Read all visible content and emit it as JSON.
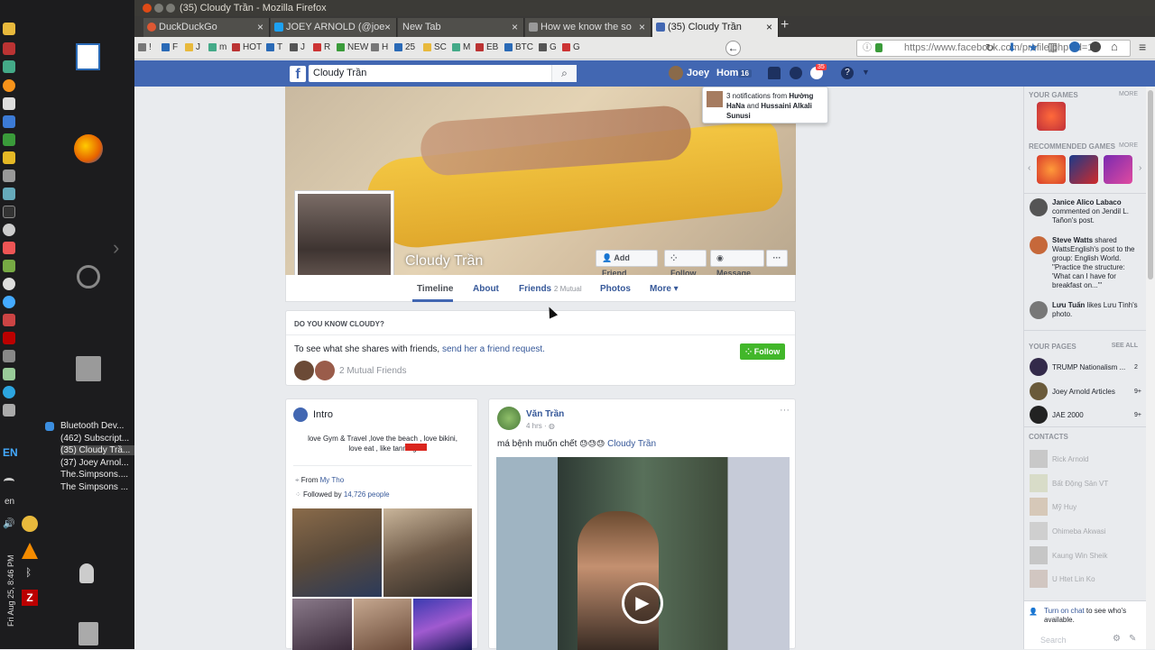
{
  "window": {
    "title": "(35) Cloudy Trần - Mozilla Firefox"
  },
  "tabs": [
    {
      "label": "DuckDuckGo",
      "color": "#de5833"
    },
    {
      "label": "JOEY ARNOLD (@joe",
      "color": "#1da1f2"
    },
    {
      "label": "New Tab",
      "color": ""
    },
    {
      "label": "How we know the so",
      "color": "#555555"
    },
    {
      "label": "(35) Cloudy Trần",
      "color": "#4267b2"
    }
  ],
  "toolbar": {
    "url": "https://www.facebook.com/profile.php?id=10",
    "bookmarks": [
      "!",
      "F",
      "J",
      "m",
      "HOT",
      "T",
      "J",
      "R",
      "NEW",
      "H",
      "25",
      "SC",
      "M",
      "EB",
      "BTC",
      "G",
      "G"
    ]
  },
  "launcher": {
    "taskbar_items": [
      "Bluetooth Dev...",
      "(462) Subscript...",
      "(35) Cloudy Trầ...",
      "(37) Joey Arnol...",
      "The.Simpsons....",
      "The Simpsons ..."
    ],
    "lang": "EN",
    "lang2": "en",
    "clock": "Fri Aug 25, 8:46 PM"
  },
  "fb": {
    "search_value": "Cloudy Trần",
    "user": "Joey",
    "home": "Home",
    "home_count": "16",
    "notif_count": "35",
    "notif_popup": {
      "pre": "3 notifications from ",
      "name1": "Hường HaNa",
      "and": " and ",
      "name2": "Hussaini Alkali Sunusi"
    },
    "profile_name": "Cloudy Trần",
    "buttons": {
      "add_friend": "Add Friend",
      "follow": "Follow",
      "message": "Message",
      "more": "···"
    },
    "profile_tabs": {
      "timeline": "Timeline",
      "about": "About",
      "friends": "Friends",
      "mutual": "2 Mutual",
      "photos": "Photos",
      "more": "More ▾"
    },
    "know": {
      "header": "DO YOU KNOW CLOUDY?",
      "text": "To see what she shares with friends, ",
      "link": "send her a friend request.",
      "mutual": "2 Mutual Friends",
      "follow": "Follow"
    },
    "intro": {
      "title": "Intro",
      "bio": "love Gym & Travel ,love the beach , love bikini, love eat , like tanning",
      "from_label": "From ",
      "from_place": "My Tho",
      "followed_label": "Followed by ",
      "followed_count": "14,726 people"
    },
    "post": {
      "author": "Văn Trần",
      "time": "4 hrs · ",
      "text": "má bệnh muốn chết",
      "emojis": "😓😓😓",
      "tag": "Cloudy Trần",
      "more": "···"
    }
  },
  "sidebar": {
    "your_games": "YOUR GAMES",
    "more": "MORE",
    "recommended": "RECOMMENDED GAMES",
    "ticker": [
      {
        "name": "Janice Alico Labaco",
        "text": " commented on Jendil L. Tañon's post."
      },
      {
        "name": "Steve Watts",
        "text": " shared WattsEnglish's post to the group: English World. \"Practice the structure: 'What can I have for breakfast on...'\""
      },
      {
        "name": "Lưu Tuấn",
        "text": " likes Lưu Tình's photo."
      }
    ],
    "your_pages": "YOUR PAGES",
    "see_all": "SEE ALL",
    "pages": [
      {
        "name": "TRUMP Nationalism ...",
        "count": "2"
      },
      {
        "name": "Joey Arnold Articles",
        "count": "9+"
      },
      {
        "name": "JAE 2000",
        "count": "9+"
      }
    ],
    "contacts_header": "CONTACTS",
    "contacts": [
      "Rick Arnold",
      "Bất Động Sản VT",
      "Mỹ Huy",
      "Ohimeba Akwasi",
      "Kaung Win Sheik",
      "U Htet Lin Ko"
    ],
    "chat_link": "Turn on chat",
    "chat_text": " to see who's available.",
    "search_placeholder": "Search"
  }
}
